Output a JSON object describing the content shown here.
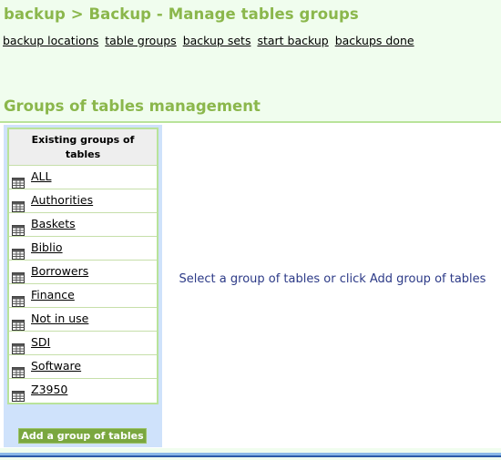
{
  "header": {
    "title": "backup > Backup - Manage tables groups",
    "nav": [
      {
        "label": "backup locations"
      },
      {
        "label": "table groups"
      },
      {
        "label": "backup sets"
      },
      {
        "label": "start backup"
      },
      {
        "label": "backups done"
      }
    ]
  },
  "section": {
    "title": "Groups of tables management"
  },
  "sidebar": {
    "header_line1": "Existing groups of",
    "header_line2": "tables",
    "groups": [
      {
        "label": "ALL"
      },
      {
        "label": "Authorities"
      },
      {
        "label": "Baskets"
      },
      {
        "label": "Biblio"
      },
      {
        "label": "Borrowers"
      },
      {
        "label": "Finance"
      },
      {
        "label": "Not in use"
      },
      {
        "label": "SDI"
      },
      {
        "label": "Software"
      },
      {
        "label": "Z3950"
      }
    ],
    "add_button": "Add a group of tables"
  },
  "main": {
    "message": "Select a group of tables or click Add group of tables"
  },
  "icons": {
    "row_icon": "table-icon"
  },
  "colors": {
    "title": "#8bb74c",
    "background": "#f0fdee",
    "sidebar": "#cfe2fb",
    "button": "#7aa73f",
    "message": "#2c3a87"
  }
}
